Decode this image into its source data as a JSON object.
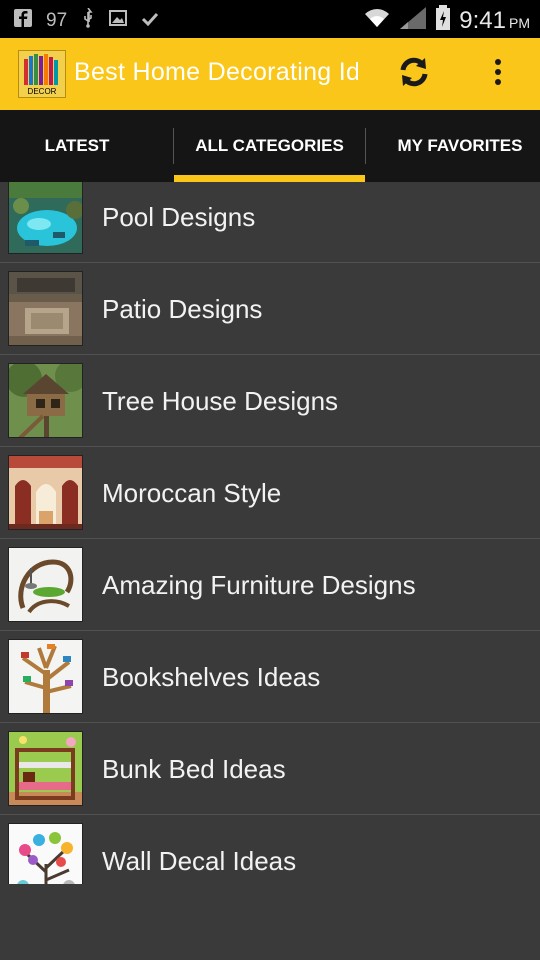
{
  "status_bar": {
    "notification_count": "97",
    "time": "9:41",
    "ampm": "PM"
  },
  "action_bar": {
    "title": "Best Home Decorating Ideas",
    "logo_text": "DECOR",
    "refresh_icon": "refresh-icon",
    "overflow_icon": "overflow-menu-icon"
  },
  "tabs": [
    {
      "label": "LATEST",
      "selected": false
    },
    {
      "label": "ALL CATEGORIES",
      "selected": true
    },
    {
      "label": "MY FAVORITES",
      "selected": false
    }
  ],
  "categories": [
    {
      "label": "Pool Designs",
      "image": "pool"
    },
    {
      "label": "Patio Designs",
      "image": "patio"
    },
    {
      "label": "Tree House Designs",
      "image": "tree-house"
    },
    {
      "label": "Moroccan Style",
      "image": "moroccan-room"
    },
    {
      "label": "Amazing Furniture Designs",
      "image": "curved-chair"
    },
    {
      "label": "Bookshelves Ideas",
      "image": "tree-bookshelf"
    },
    {
      "label": "Bunk Bed Ideas",
      "image": "bunk-bed"
    },
    {
      "label": "Wall Decal Ideas",
      "image": "wall-decal-tree"
    }
  ],
  "colors": {
    "accent": "#fac619",
    "tab_bar": "#151515",
    "list_background": "#3a3a3a",
    "status_bar": "#000000"
  }
}
